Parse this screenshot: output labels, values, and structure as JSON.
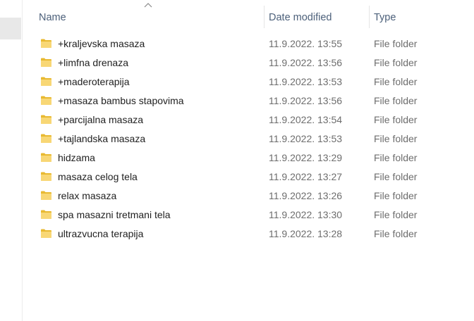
{
  "columns": {
    "name": "Name",
    "date_modified": "Date modified",
    "type": "Type"
  },
  "sort_indicator_icon": "chevron-up-icon",
  "folder_icon": "folder-icon",
  "colors": {
    "folder": "#f8d775",
    "folder_dark": "#e8b931",
    "header_text": "#4c607a",
    "secondary_text": "#6d6d6d"
  },
  "files": [
    {
      "name": "+kraljevska masaza",
      "date": "11.9.2022. 13:55",
      "type": "File folder"
    },
    {
      "name": "+limfna drenaza",
      "date": "11.9.2022. 13:56",
      "type": "File folder"
    },
    {
      "name": "+maderoterapija",
      "date": "11.9.2022. 13:53",
      "type": "File folder"
    },
    {
      "name": "+masaza bambus stapovima",
      "date": "11.9.2022. 13:56",
      "type": "File folder"
    },
    {
      "name": "+parcijalna masaza",
      "date": "11.9.2022. 13:54",
      "type": "File folder"
    },
    {
      "name": "+tajlandska masaza",
      "date": "11.9.2022. 13:53",
      "type": "File folder"
    },
    {
      "name": "hidzama",
      "date": "11.9.2022. 13:29",
      "type": "File folder"
    },
    {
      "name": "masaza celog tela",
      "date": "11.9.2022. 13:27",
      "type": "File folder"
    },
    {
      "name": "relax masaza",
      "date": "11.9.2022. 13:26",
      "type": "File folder"
    },
    {
      "name": "spa masazni tretmani tela",
      "date": "11.9.2022. 13:30",
      "type": "File folder"
    },
    {
      "name": "ultrazvucna terapija",
      "date": "11.9.2022. 13:28",
      "type": "File folder"
    }
  ]
}
